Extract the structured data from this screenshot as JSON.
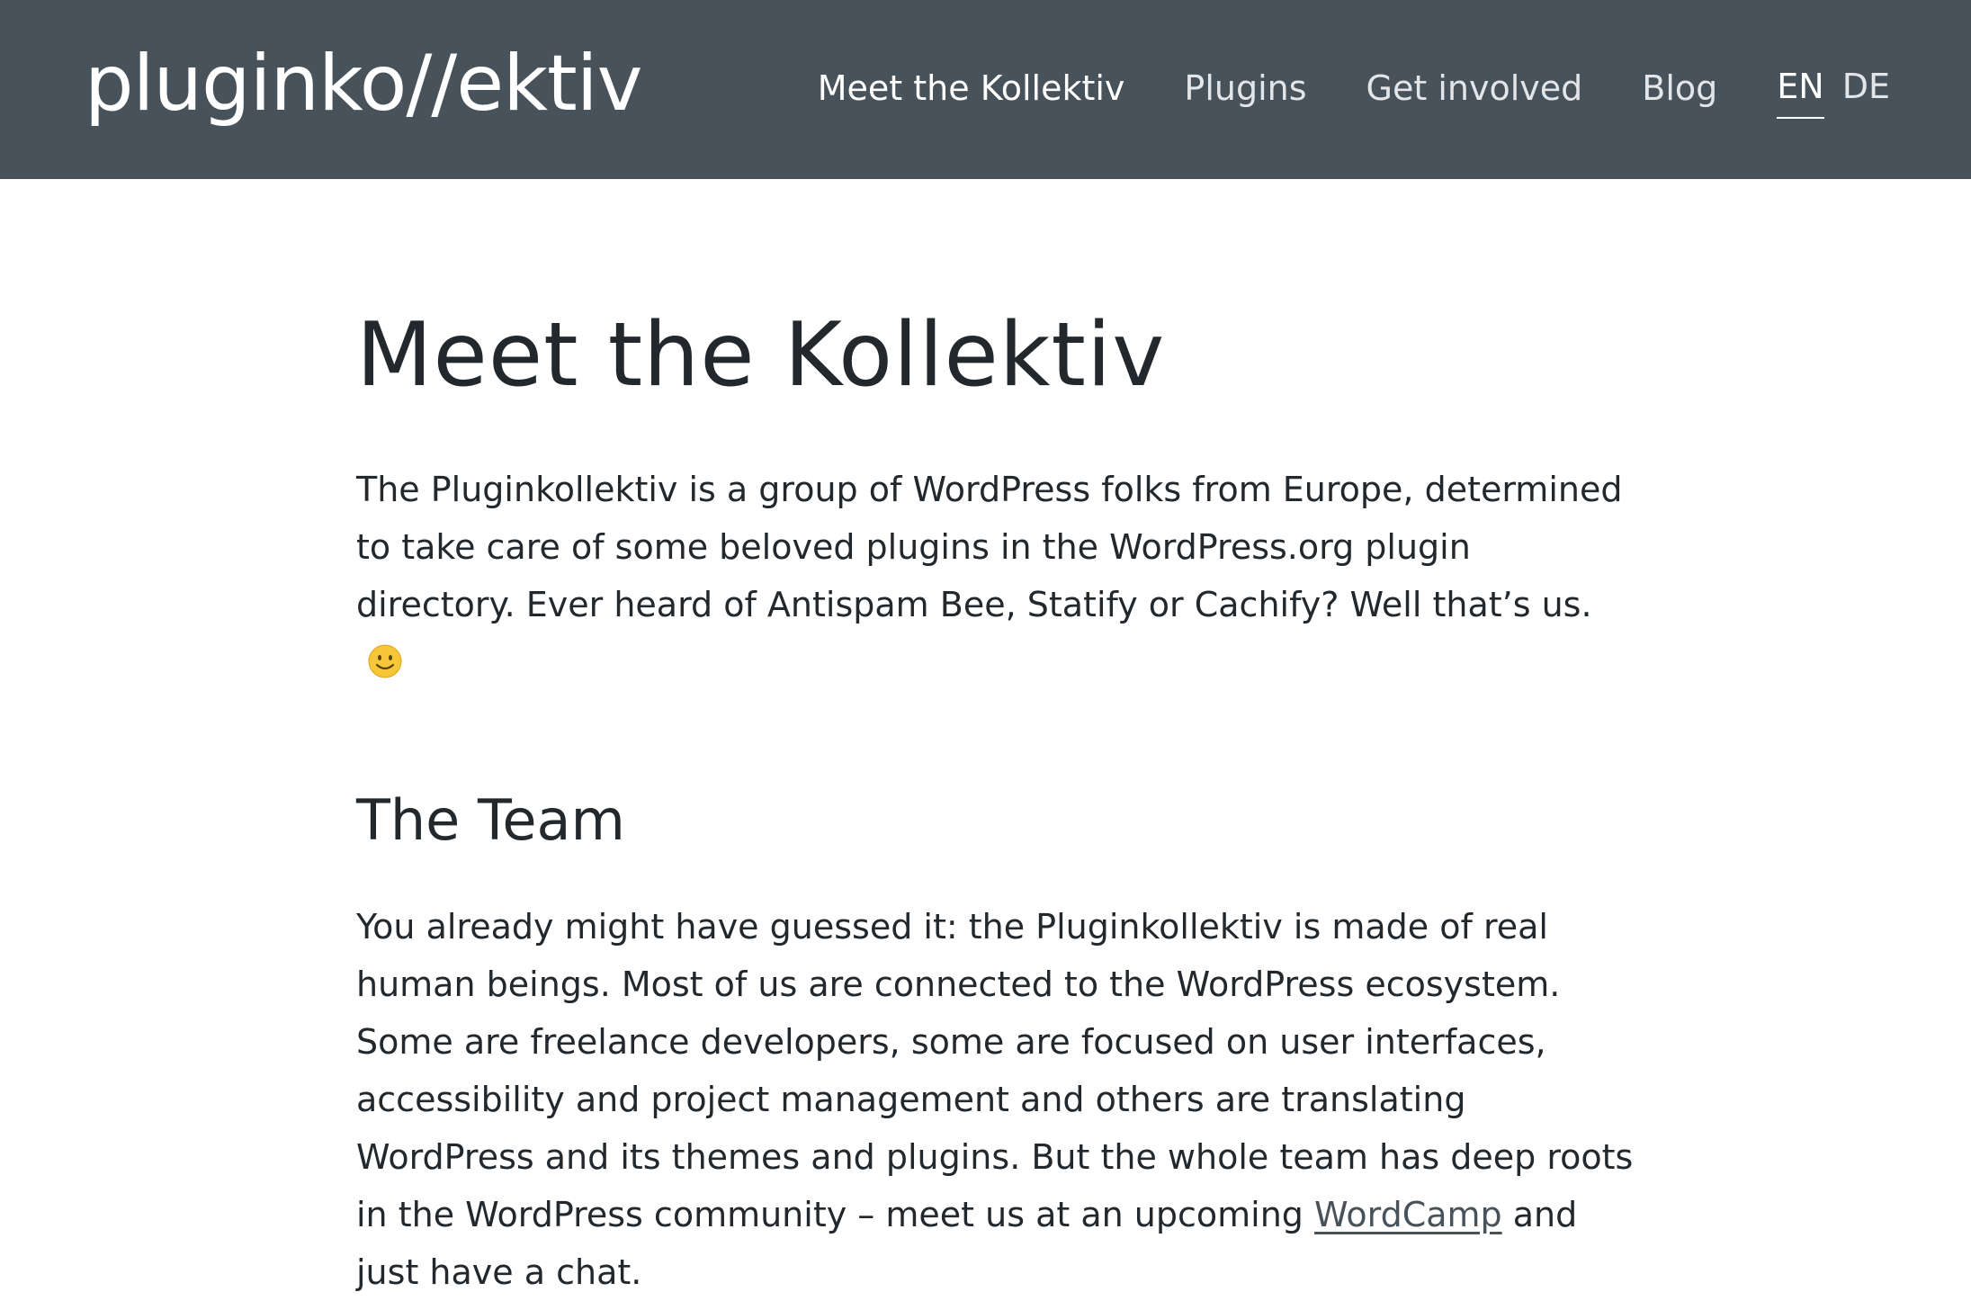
{
  "header": {
    "logo": "pluginko//ektiv",
    "nav": [
      {
        "label": "Meet the Kollektiv"
      },
      {
        "label": "Plugins"
      },
      {
        "label": "Get involved"
      },
      {
        "label": "Blog"
      }
    ],
    "languages": [
      {
        "label": "EN",
        "active": true
      },
      {
        "label": "DE",
        "active": false
      }
    ]
  },
  "main": {
    "title": "Meet the Kollektiv",
    "intro": "The Pluginkollektiv is a group of WordPress folks from Europe, determined to take care of some beloved plugins in the WordPress.org plugin directory. Ever heard of Antispam Bee, Statify or Cachify? Well that’s us.",
    "intro_emoji": "smiling-face-icon",
    "team_heading": "The Team",
    "team_text_before": "You already might have guessed it: the Pluginkollektiv is made of real human beings. Most of us are connected to the WordPress ecosystem. Some are freelance developers, some are focused on user interfaces, accessibility and project management and others are translating WordPress and its themes and plugins. But the whole team has deep roots in the WordPress community – meet us at an upcoming",
    "team_link": "WordCamp",
    "team_text_after": "and just have a chat."
  },
  "colors": {
    "header_bg": "#48525b",
    "text": "#23282d",
    "link": "#48525b",
    "emoji": "#f7c739"
  }
}
